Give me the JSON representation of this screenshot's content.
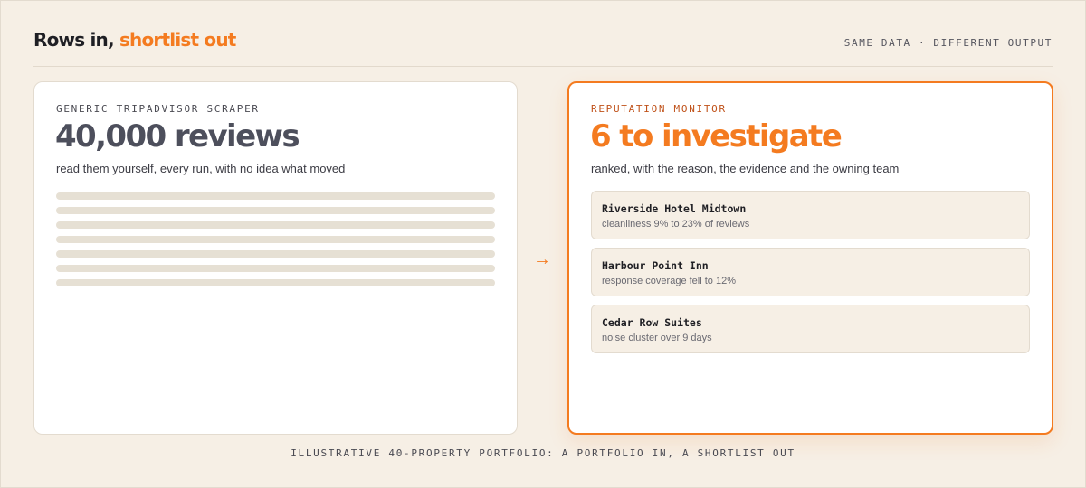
{
  "header": {
    "title_main": "Rows in,",
    "title_accent": "shortlist out",
    "tagline": "SAME DATA · DIFFERENT OUTPUT"
  },
  "left_card": {
    "eyebrow": "GENERIC TRIPADVISOR SCRAPER",
    "headline": "40,000 reviews",
    "subtitle": "read them yourself, every run, with no idea what moved",
    "placeholder_line_count": 7
  },
  "arrow": "→",
  "right_card": {
    "eyebrow": "REPUTATION MONITOR",
    "headline": "6 to investigate",
    "subtitle": "ranked, with the reason, the evidence and the owning team",
    "items": [
      {
        "name": "Riverside Hotel Midtown",
        "detail": "cleanliness 9% to 23% of reviews"
      },
      {
        "name": "Harbour Point Inn",
        "detail": "response coverage fell to 12%"
      },
      {
        "name": "Cedar Row Suites",
        "detail": "noise cluster over 9 days"
      }
    ]
  },
  "footer": "ILLUSTRATIVE 40-PROPERTY PORTFOLIO: A PORTFOLIO IN, A SHORTLIST OUT",
  "colors": {
    "background": "#f6efe5",
    "accent": "#f47b20",
    "accent_dark": "#c0521a",
    "headline_gray": "#4d4f5c",
    "placeholder_line": "#e6e0d4"
  }
}
